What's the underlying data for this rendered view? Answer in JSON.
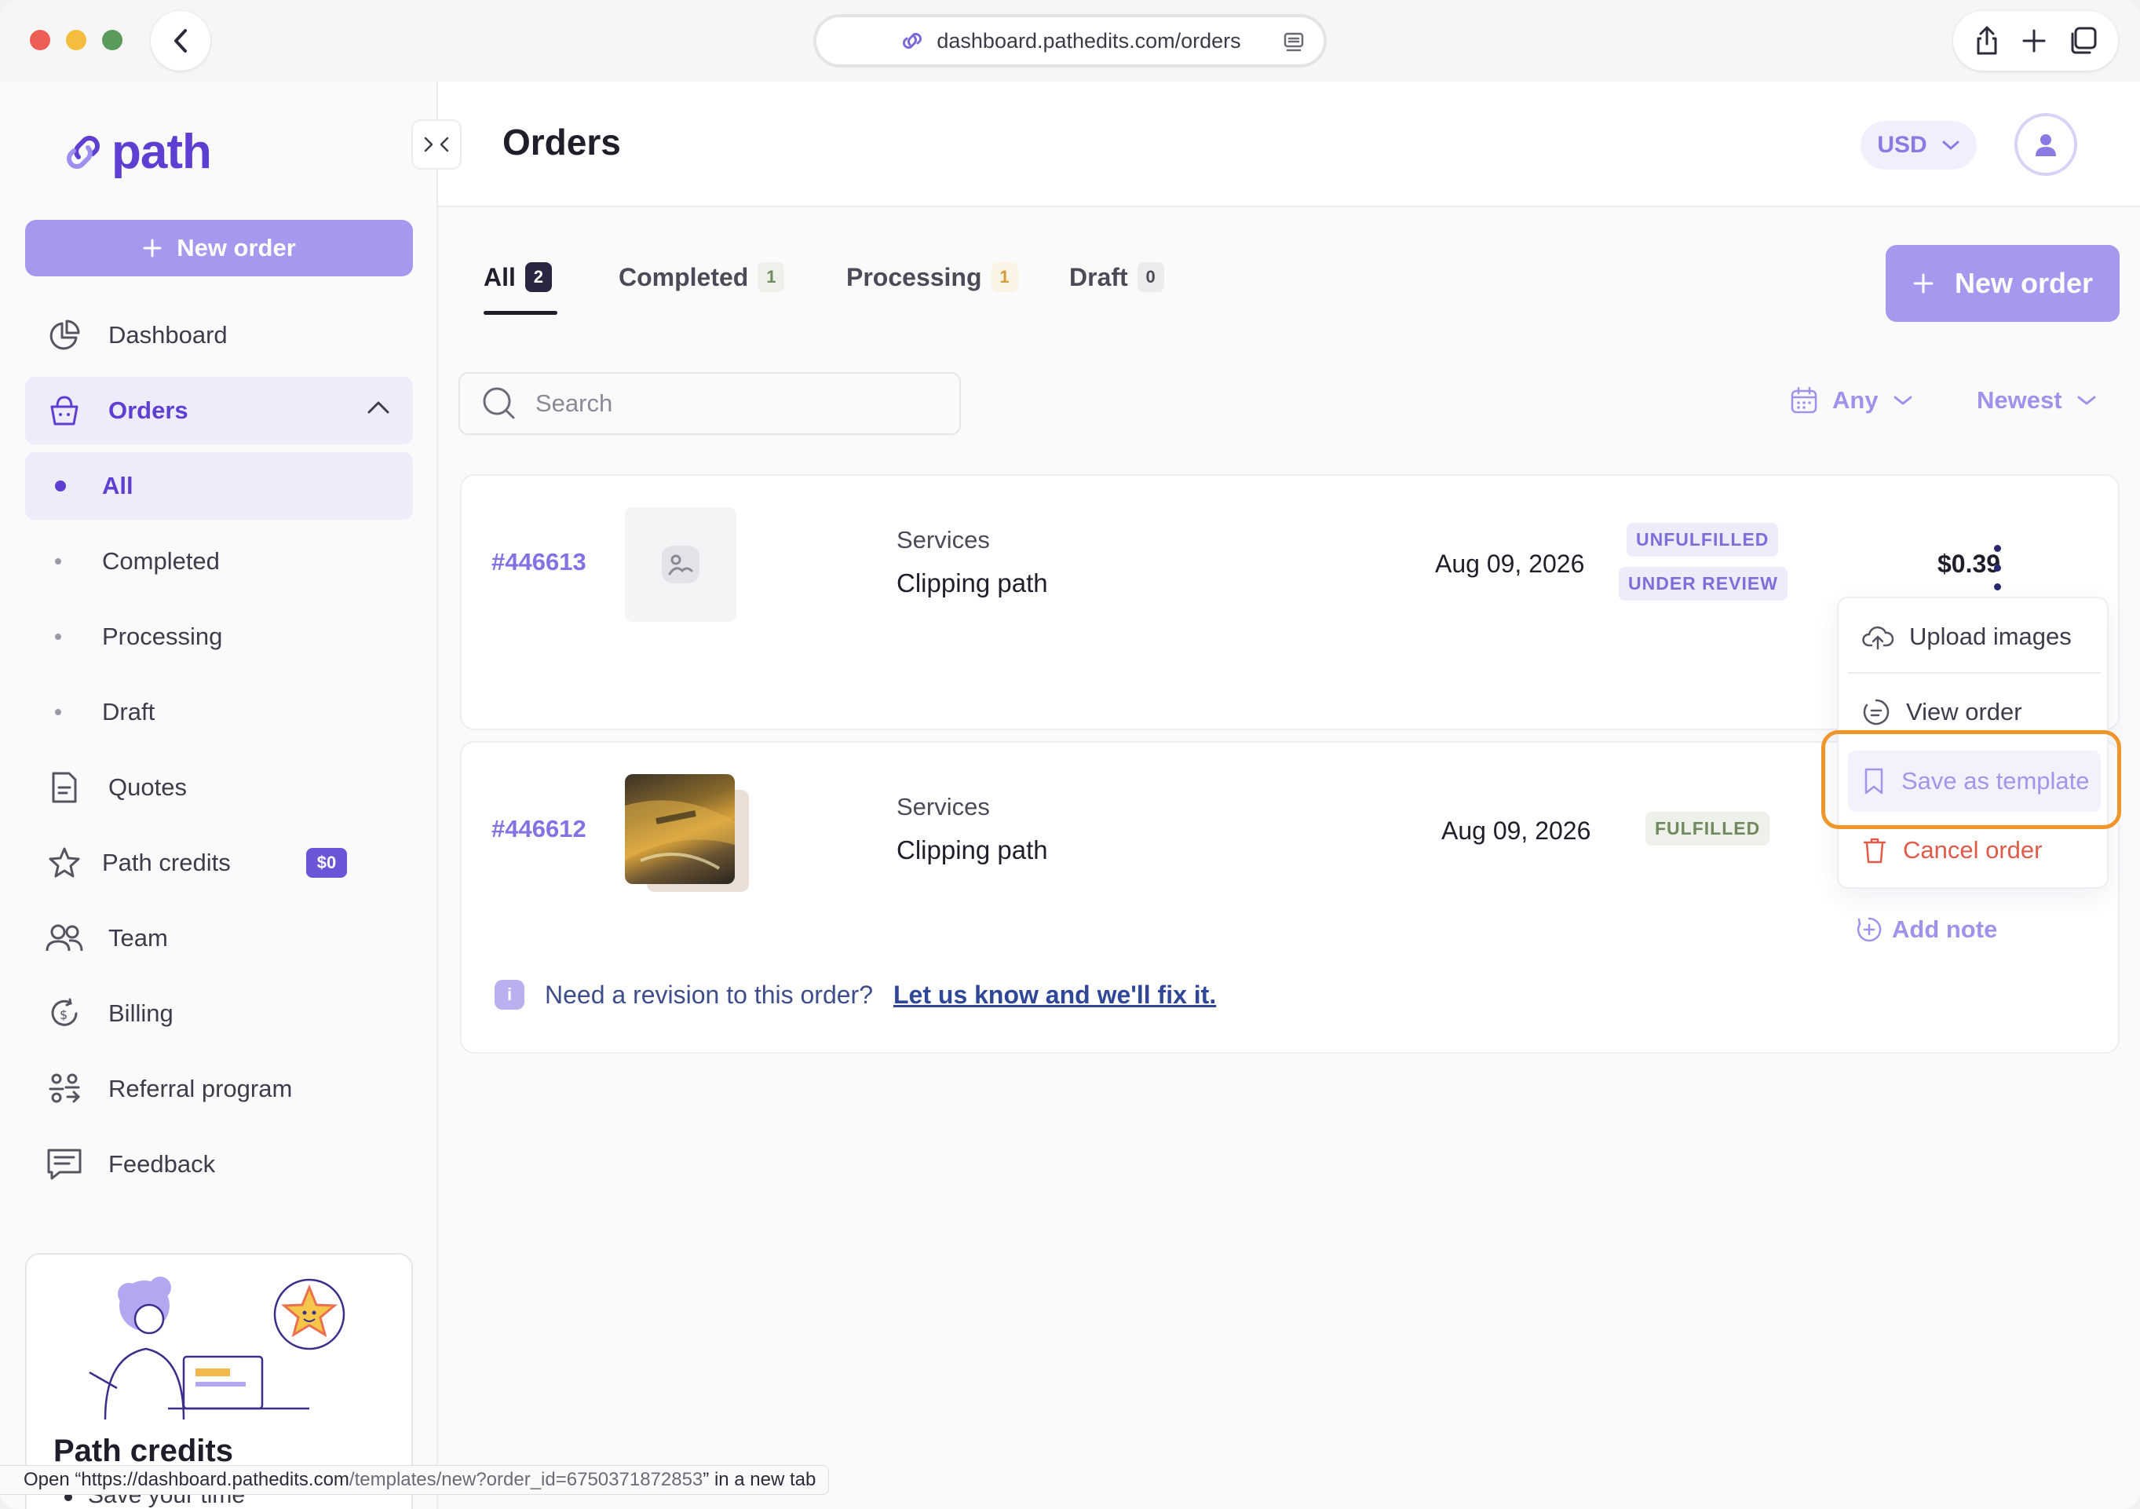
{
  "browser": {
    "url": "dashboard.pathedits.com/orders",
    "status_prefix": "Open “https://dashboard.pathedits.com",
    "status_path": "/templates/new?order_id=6750371872853",
    "status_suffix": "” in a new tab"
  },
  "sidebar": {
    "logo": "path",
    "new_order": "New order",
    "items": {
      "dashboard": "Dashboard",
      "orders": "Orders",
      "all": "All",
      "completed": "Completed",
      "processing": "Processing",
      "draft": "Draft",
      "quotes": "Quotes",
      "path_credits": "Path credits",
      "credits_badge": "$0",
      "team": "Team",
      "billing": "Billing",
      "referral": "Referral program",
      "feedback": "Feedback"
    },
    "promo": {
      "title": "Path credits",
      "bullet": "Save your time"
    }
  },
  "header": {
    "title": "Orders",
    "currency": "USD"
  },
  "tabs": [
    {
      "label": "All",
      "count": "2"
    },
    {
      "label": "Completed",
      "count": "1"
    },
    {
      "label": "Processing",
      "count": "1"
    },
    {
      "label": "Draft",
      "count": "0"
    }
  ],
  "toolbar": {
    "new_order": "New order",
    "search_placeholder": "Search",
    "date_filter": "Any",
    "sort": "Newest"
  },
  "orders": [
    {
      "id": "#446613",
      "service_label": "Services",
      "service": "Clipping path",
      "date": "Aug 09, 2026",
      "status_1": "UNFULFILLED",
      "status_2": "UNDER REVIEW",
      "price": "$0.39"
    },
    {
      "id": "#446612",
      "service_label": "Services",
      "service": "Clipping path",
      "date": "Aug 09, 2026",
      "status_1": "FULFILLED",
      "revision_text": "Need a revision to this order?",
      "revision_link": "Let us know and we'll fix it."
    }
  ],
  "menu": {
    "upload": "Upload images",
    "view": "View order",
    "save_template": "Save as template",
    "cancel": "Cancel order",
    "add_note": "Add note"
  },
  "colors": {
    "brand": "#5e3fd1",
    "button": "#a598ee",
    "danger": "#e05a48",
    "highlight_ring": "#f0952a"
  }
}
